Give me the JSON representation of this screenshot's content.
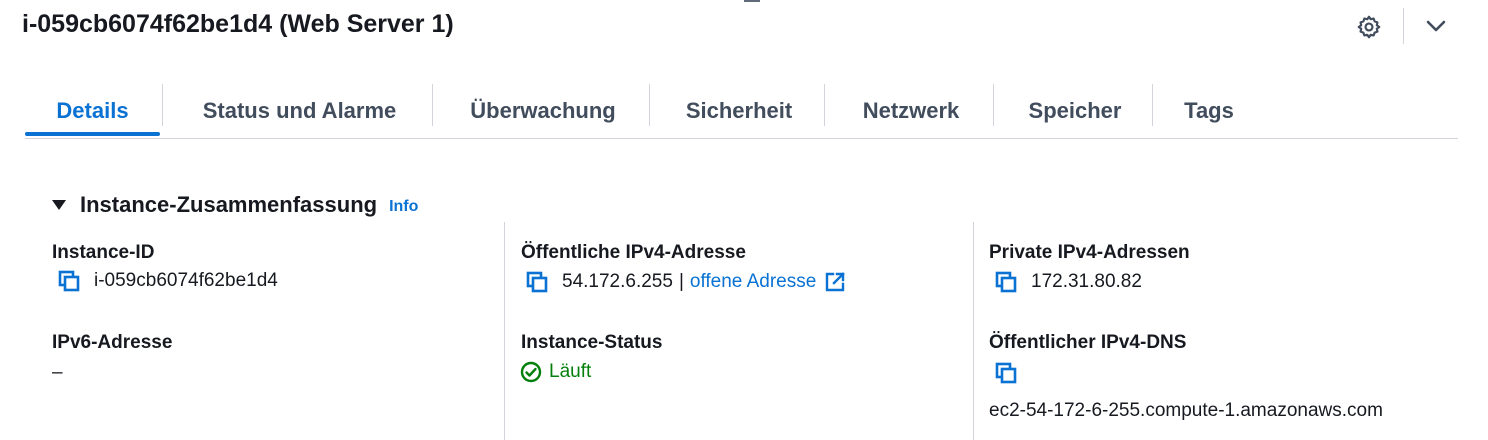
{
  "header": {
    "title": "i-059cb6074f62be1d4 (Web Server 1)",
    "icons": [
      "gear-icon",
      "chevron-down-icon"
    ]
  },
  "tabs": [
    {
      "label": "Details",
      "active": true
    },
    {
      "label": "Status und Alarme",
      "active": false
    },
    {
      "label": "Überwachung",
      "active": false
    },
    {
      "label": "Sicherheit",
      "active": false
    },
    {
      "label": "Netzwerk",
      "active": false
    },
    {
      "label": "Speicher",
      "active": false
    },
    {
      "label": "Tags",
      "active": false
    }
  ],
  "summary": {
    "title": "Instance-Zusammenfassung",
    "info_label": "Info",
    "fields": {
      "instance_id": {
        "label": "Instance-ID",
        "value": "i-059cb6074f62be1d4"
      },
      "public_ipv4": {
        "label": "Öffentliche IPv4-Adresse",
        "value": "54.172.6.255",
        "separator": "|",
        "link_text": "offene Adresse"
      },
      "private_ipv4": {
        "label": "Private IPv4-Adressen",
        "value": "172.31.80.82"
      },
      "ipv6": {
        "label": "IPv6-Adresse",
        "value": "–"
      },
      "instance_status": {
        "label": "Instance-Status",
        "value": "Läuft"
      },
      "public_dns": {
        "label": "Öffentlicher IPv4-DNS",
        "value": "ec2-54-172-6-255.compute-1.amazonaws.com"
      }
    }
  },
  "colors": {
    "accent": "#0972d3",
    "text": "#16191f",
    "tab_inactive": "#414d5c",
    "success": "#037f0c",
    "divider": "#d1d5db"
  }
}
